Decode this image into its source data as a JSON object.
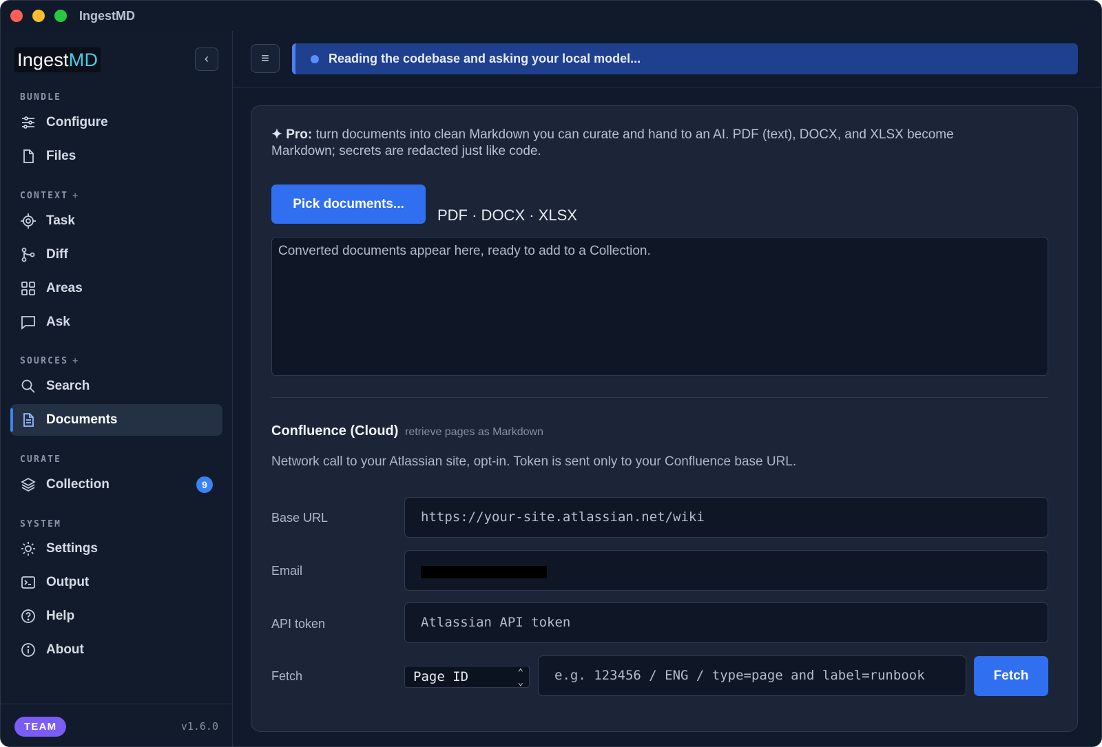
{
  "app": {
    "title": "IngestMD"
  },
  "logo": {
    "part1": "Ingest",
    "part2": "MD"
  },
  "sidebar": {
    "collapse_icon": "chevron-left-icon",
    "sections": {
      "bundle": "BUNDLE",
      "context": "CONTEXT",
      "sources": "SOURCES",
      "curate": "CURATE",
      "system": "SYSTEM",
      "plus": "+"
    },
    "items": {
      "configure": "Configure",
      "files": "Files",
      "task": "Task",
      "diff": "Diff",
      "areas": "Areas",
      "ask": "Ask",
      "search": "Search",
      "documents": "Documents",
      "collection": "Collection",
      "collection_count": "9",
      "settings": "Settings",
      "output": "Output",
      "help": "Help",
      "about": "About"
    },
    "active_item": "Documents",
    "footer": {
      "plan": "TEAM",
      "version": "v1.6.0"
    }
  },
  "topbar": {
    "menu_icon": "hamburger-icon",
    "status": "Reading the codebase and asking your local model..."
  },
  "documents": {
    "pro_label": "✦ Pro:",
    "pro_text": "turn documents into clean Markdown you can curate and hand to an AI. PDF (text), DOCX, and XLSX become Markdown; secrets are redacted just like code.",
    "pick_button": "Pick documents...",
    "formats": "PDF · DOCX · XLSX",
    "output_placeholder": "Converted documents appear here, ready to add to a Collection."
  },
  "confluence": {
    "title": "Confluence (Cloud)",
    "subtitle": "retrieve pages as Markdown",
    "description": "Network call to your Atlassian site, opt-in. Token is sent only to your Confluence base URL.",
    "base_url_label": "Base URL",
    "base_url_placeholder": "https://your-site.atlassian.net/wiki",
    "email_label": "Email",
    "token_label": "API token",
    "token_placeholder": "Atlassian API token",
    "fetch_label": "Fetch",
    "fetch_mode": "Page ID",
    "fetch_placeholder": "e.g. 123456 / ENG / type=page and label=runbook",
    "fetch_button": "Fetch"
  },
  "colors": {
    "accent": "#2f6ff0",
    "banner": "#1f3f8f",
    "badge_team": "#7c5cf6",
    "background": "#111a2b"
  }
}
